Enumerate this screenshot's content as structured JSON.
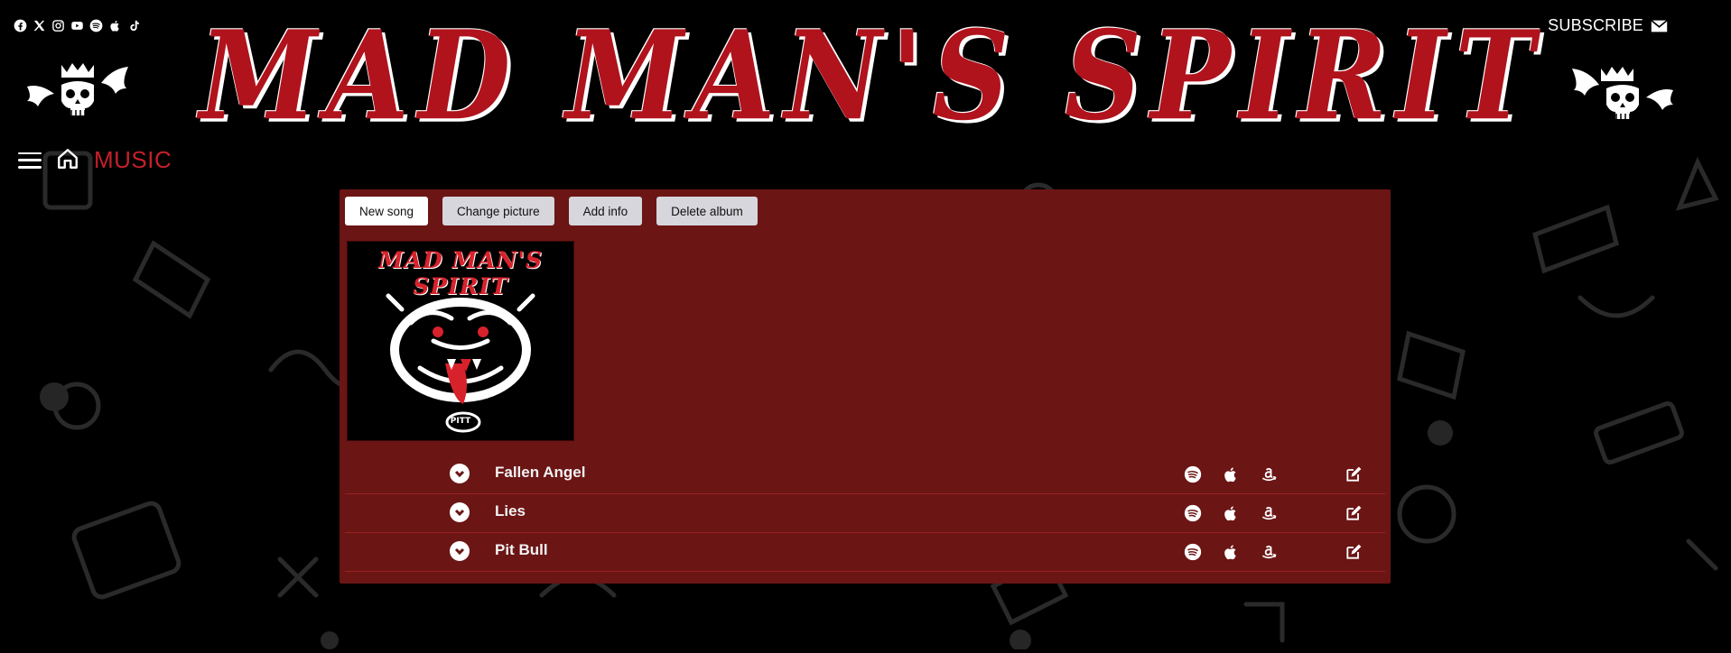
{
  "header": {
    "banner_title": "MAD MAN'S SPIRIT",
    "subscribe_label": "SUBSCRIBE",
    "social_icons": [
      "facebook-icon",
      "x-icon",
      "instagram-icon",
      "youtube-icon",
      "spotify-icon",
      "apple-icon",
      "tiktok-icon"
    ]
  },
  "nav": {
    "section_label": "MUSIC"
  },
  "toolbar": {
    "new_song_label": "New song",
    "change_picture_label": "Change picture",
    "add_info_label": "Add info",
    "delete_album_label": "Delete album"
  },
  "album": {
    "cover_title": "MAD MAN'S SPIRIT",
    "cover_caption": "PITT"
  },
  "songs": [
    {
      "title": "Fallen Angel"
    },
    {
      "title": "Lies"
    },
    {
      "title": "Pit Bull"
    }
  ],
  "colors": {
    "background": "#000000",
    "panel": "#6b1515",
    "accent_red": "#b0131c",
    "nav_red": "#c4202a",
    "button_gray": "#d6d6dc"
  }
}
